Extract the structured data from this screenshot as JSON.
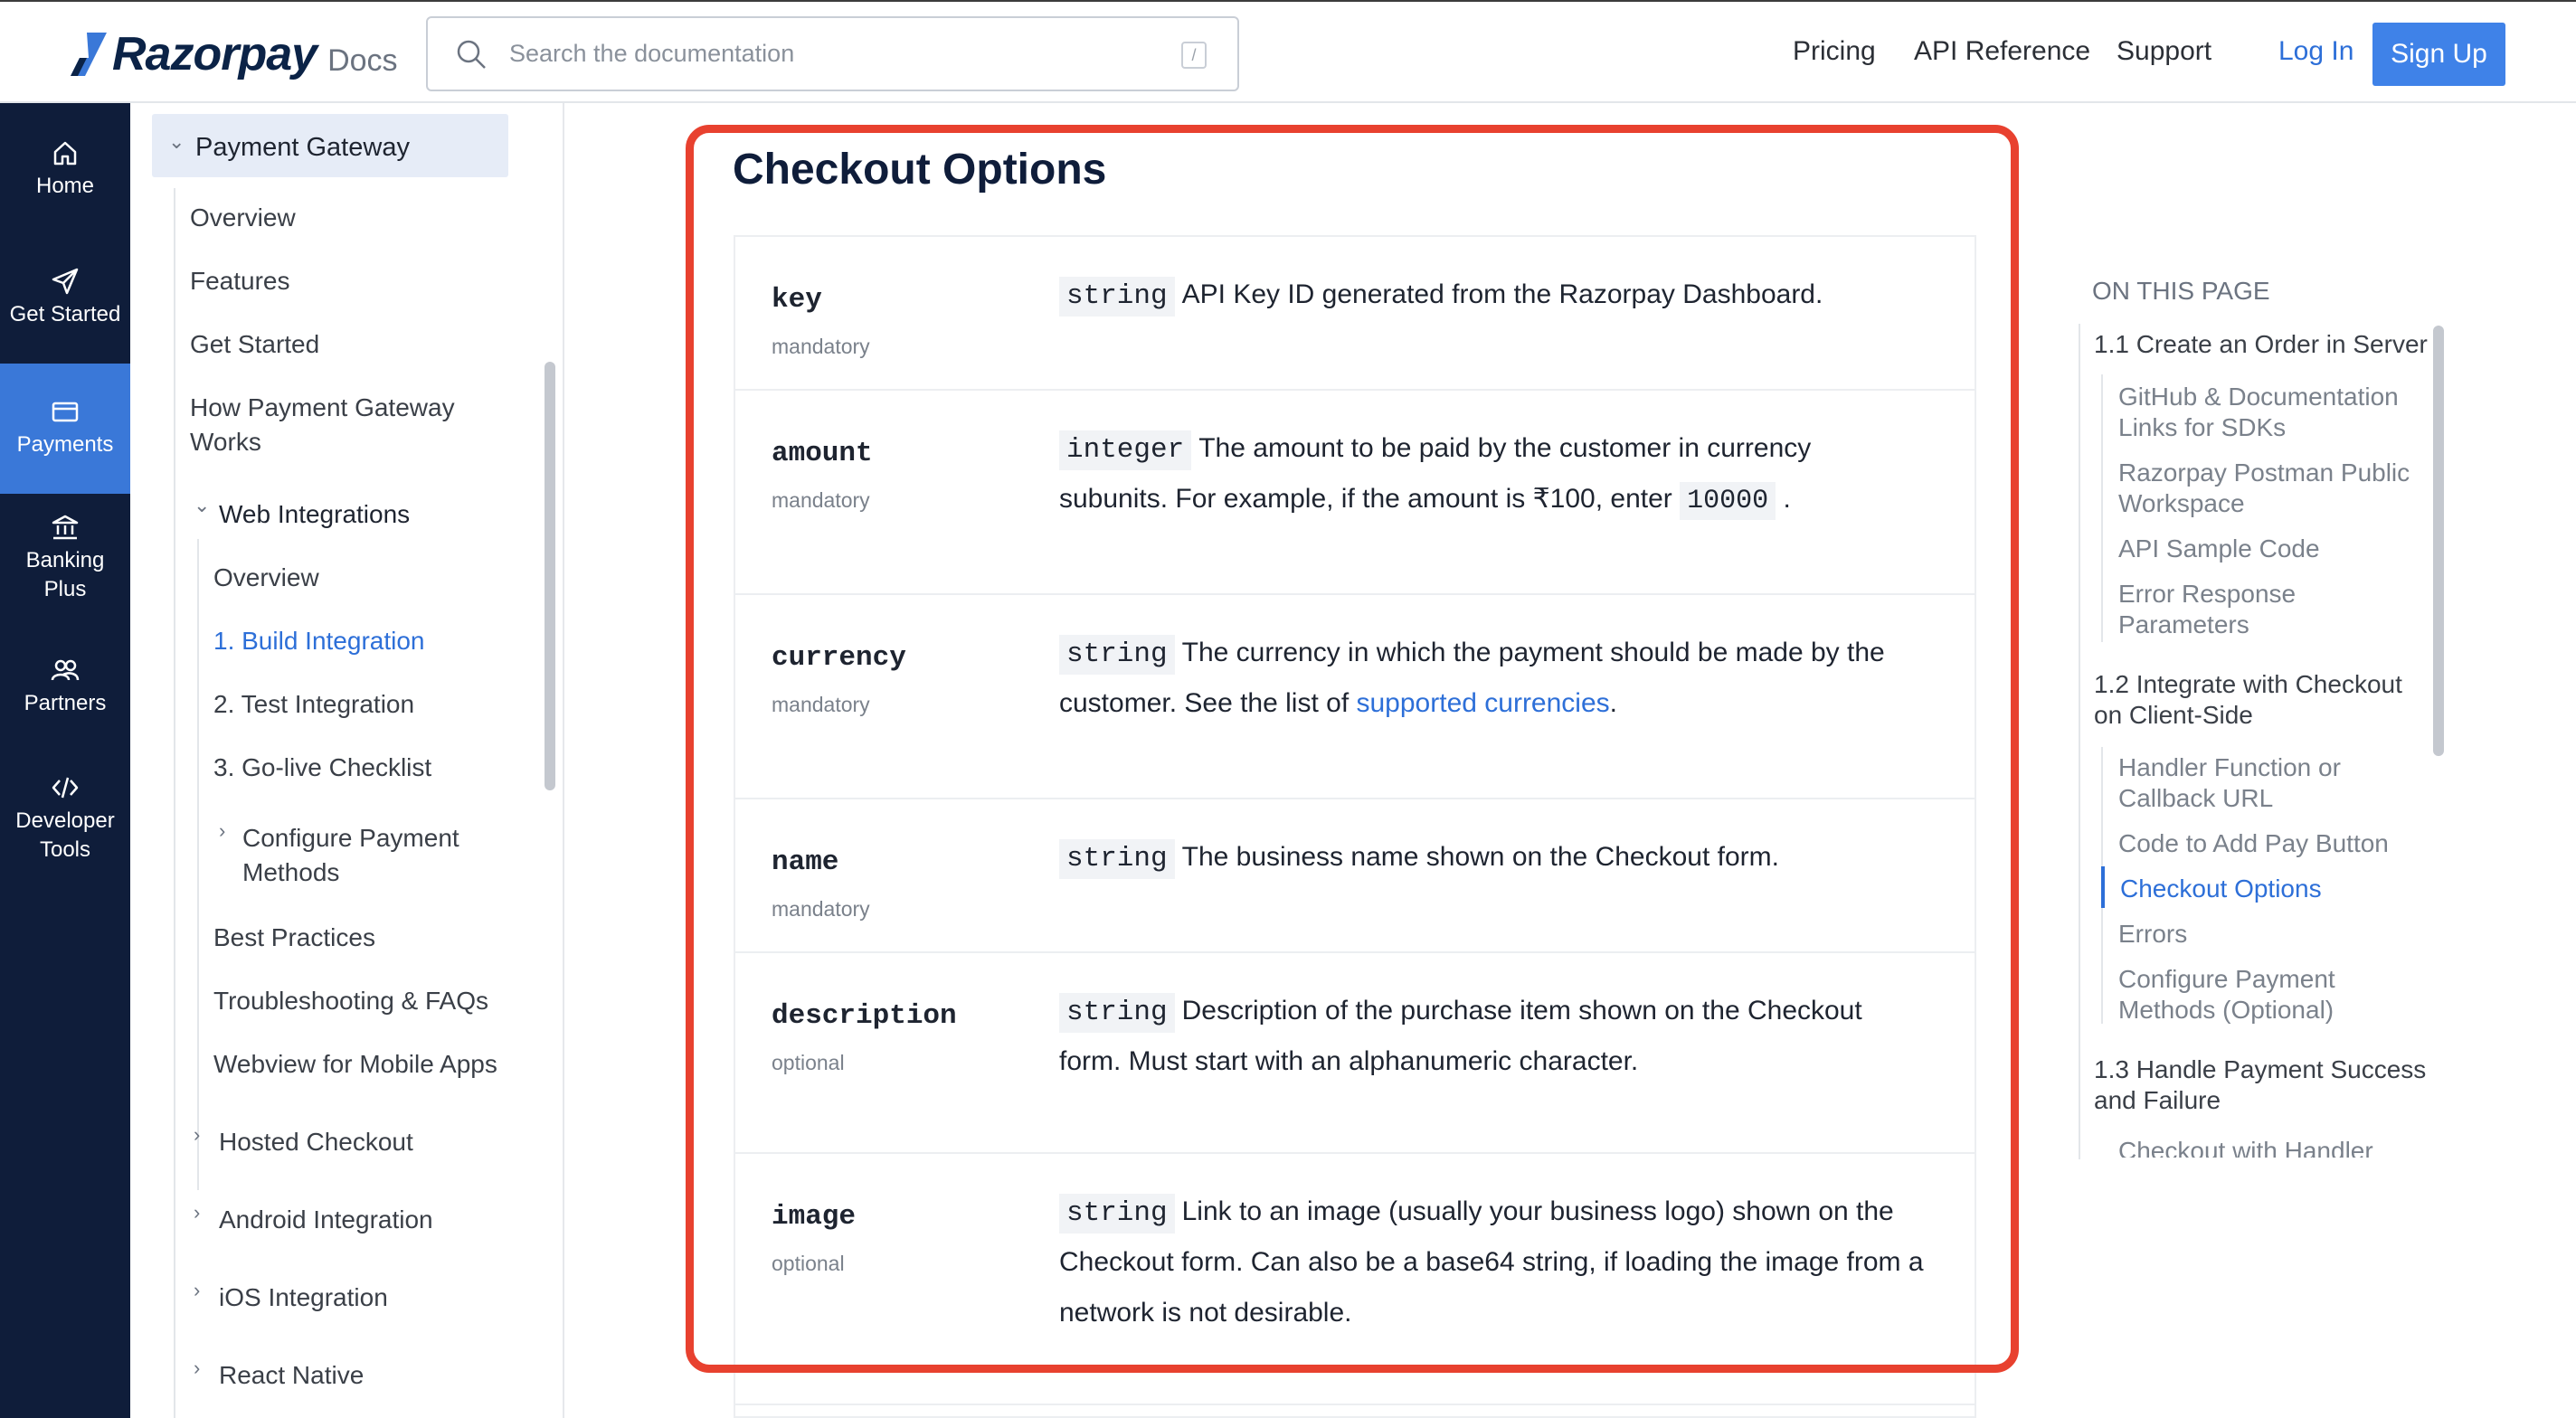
{
  "header": {
    "logo_text": "Razorpay",
    "logo_suffix": "Docs",
    "search_placeholder": "Search the documentation",
    "search_shortcut": "/",
    "nav": {
      "pricing": "Pricing",
      "api_reference": "API Reference",
      "support": "Support",
      "login": "Log In",
      "signup": "Sign Up"
    }
  },
  "rail": {
    "items": [
      {
        "label": "Home",
        "icon": "home-icon"
      },
      {
        "label": "Get Started",
        "icon": "paper-plane-icon"
      },
      {
        "label": "Payments",
        "icon": "card-icon",
        "active": true
      },
      {
        "label": "Banking Plus",
        "icon": "bank-icon"
      },
      {
        "label": "Partners",
        "icon": "users-icon"
      },
      {
        "label": "Developer Tools",
        "icon": "code-icon"
      }
    ]
  },
  "sidebar": {
    "section": "Payment Gateway",
    "items": [
      "Overview",
      "Features",
      "Get Started",
      "How Payment Gateway Works",
      "Web Integrations",
      "Overview",
      "1. Build Integration",
      "2. Test Integration",
      "3. Go-live Checklist",
      "Configure Payment Methods",
      "Best Practices",
      "Troubleshooting & FAQs",
      "Webview for Mobile Apps",
      "Hosted Checkout",
      "Android Integration",
      "iOS Integration",
      "React Native"
    ]
  },
  "main": {
    "title": "Checkout Options",
    "params": [
      {
        "name": "key",
        "req": "mandatory",
        "type": "string",
        "desc": "API Key ID generated from the Razorpay Dashboard."
      },
      {
        "name": "amount",
        "req": "mandatory",
        "type": "integer",
        "desc1": "The amount to be paid by the customer in currency",
        "desc2": "subunits. For example, if the amount is ₹100, enter",
        "code": "10000",
        "desc3": "."
      },
      {
        "name": "currency",
        "req": "mandatory",
        "type": "string",
        "desc1": "The currency in which the payment should be made by the",
        "desc2": "customer. See the list of",
        "link": "supported currencies",
        "desc3": "."
      },
      {
        "name": "name",
        "req": "mandatory",
        "type": "string",
        "desc": "The business name shown on the Checkout form."
      },
      {
        "name": "description",
        "req": "optional",
        "type": "string",
        "desc1": "Description of the purchase item shown on the Checkout",
        "desc2": "form. Must start with an alphanumeric character."
      },
      {
        "name": "image",
        "req": "optional",
        "type": "string",
        "desc1": "Link to an image (usually your business logo) shown on the",
        "desc2": "Checkout form. Can also be a",
        "code": "base64",
        "desc3": "string, if loading the image from a",
        "desc4": "network is not desirable."
      }
    ]
  },
  "toc": {
    "title": "ON THIS PAGE",
    "items": [
      "1.1 Create an Order in Server",
      "GitHub & Documentation Links for SDKs",
      "Razorpay Postman Public Workspace",
      "API Sample Code",
      "Error Response Parameters",
      "1.2 Integrate with Checkout on Client-Side",
      "Handler Function or Callback URL",
      "Code to Add Pay Button",
      "Checkout Options",
      "Errors",
      "Configure Payment Methods (Optional)",
      "1.3 Handle Payment Success and Failure",
      "Checkout with Handler"
    ]
  },
  "colors": {
    "brand_navy": "#0f1d3a",
    "accent_blue": "#2d6fd8",
    "signup_blue": "#3f82e8",
    "highlight_red": "#e8412f"
  }
}
